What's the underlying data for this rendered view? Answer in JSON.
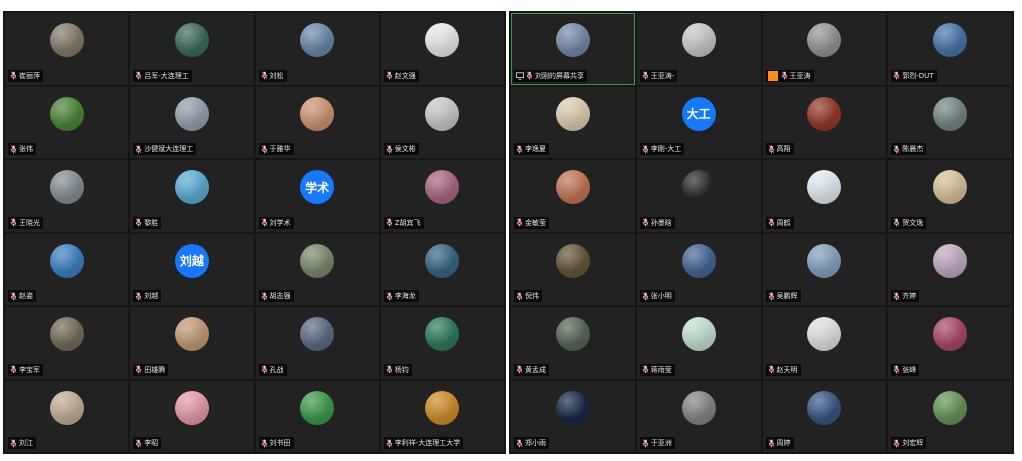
{
  "colors": {
    "background": "#161616",
    "tile": "#222222",
    "caption_bg": "#000000",
    "caption_text": "#e6e6e6",
    "active_border": "#2ea043",
    "text_avatar_blue": "#1677ff"
  },
  "left_panel": [
    {
      "name": "崔丽萍",
      "avatar": "photo",
      "color": "#8a7f6e"
    },
    {
      "name": "吕军-大连理工",
      "avatar": "photo",
      "color": "#3f6f5e"
    },
    {
      "name": "刘松",
      "avatar": "photo",
      "color": "#6f8fb0"
    },
    {
      "name": "赵文强",
      "avatar": "cartoon",
      "color": "#f2f2f2"
    },
    {
      "name": "张伟",
      "avatar": "photo",
      "color": "#4f8a3a"
    },
    {
      "name": "沙健斌大连理工",
      "avatar": "photo",
      "color": "#9aa7b5"
    },
    {
      "name": "于雅华",
      "avatar": "photo",
      "color": "#d79a7a"
    },
    {
      "name": "侯文彬",
      "avatar": "photo",
      "color": "#cfcfcf"
    },
    {
      "name": "王晓光",
      "avatar": "photo",
      "color": "#8a939b"
    },
    {
      "name": "黎胜",
      "avatar": "photo",
      "color": "#5fb3dd"
    },
    {
      "name": "刘学术",
      "avatar": "text",
      "initials": "学术",
      "color": "#1677ff"
    },
    {
      "name": "Z胡宾飞",
      "avatar": "photo",
      "color": "#b06a8a"
    },
    {
      "name": "赵姿",
      "avatar": "photo",
      "color": "#3f86c9"
    },
    {
      "name": "刘越",
      "avatar": "text",
      "initials": "刘越",
      "color": "#1677ff"
    },
    {
      "name": "胡志强",
      "avatar": "photo",
      "color": "#7f8f6f"
    },
    {
      "name": "李海龙",
      "avatar": "photo",
      "color": "#3a6a8a"
    },
    {
      "name": "李宝军",
      "avatar": "photo",
      "color": "#7a6f5a"
    },
    {
      "name": "田雄腾",
      "avatar": "photo",
      "color": "#c9a27a"
    },
    {
      "name": "孔战",
      "avatar": "photo",
      "color": "#5f6f8a"
    },
    {
      "name": "杨钧",
      "avatar": "photo",
      "color": "#2f7f5f"
    },
    {
      "name": "刘江",
      "avatar": "photo",
      "color": "#c9b49a"
    },
    {
      "name": "李昭",
      "avatar": "photo",
      "color": "#f0a0b0"
    },
    {
      "name": "刘书田",
      "avatar": "photo",
      "color": "#3fa04f"
    },
    {
      "name": "李利祥-大连理工大学",
      "avatar": "photo",
      "color": "#d7922a"
    }
  ],
  "right_panel": [
    {
      "name": "刘刚的屏幕共享",
      "avatar": "photo",
      "color": "#7a8fb0",
      "sharing": true,
      "active": true
    },
    {
      "name": "王亚涛-",
      "avatar": "photo",
      "color": "#cfcfcf"
    },
    {
      "name": "王亚涛",
      "avatar": "photo",
      "color": "#9a9a9a",
      "badge": true
    },
    {
      "name": "郭烈-DUT",
      "avatar": "photo",
      "color": "#4a7ab0"
    },
    {
      "name": "李逸夏",
      "avatar": "cartoon",
      "color": "#e7d4b5"
    },
    {
      "name": "李刚-大工",
      "avatar": "text",
      "initials": "大工",
      "color": "#1677ff"
    },
    {
      "name": "高翔",
      "avatar": "photo",
      "color": "#9a3a2a"
    },
    {
      "name": "陈晨杰",
      "avatar": "photo",
      "color": "#7a8a8a"
    },
    {
      "name": "金敏莹",
      "avatar": "photo",
      "color": "#c97a5a"
    },
    {
      "name": "孙墨晗",
      "avatar": "photo",
      "color": "#2a2a2a"
    },
    {
      "name": "周鹤",
      "avatar": "photo",
      "color": "#e9f3fa"
    },
    {
      "name": "贺文逸",
      "avatar": "photo",
      "color": "#e0c9a0"
    },
    {
      "name": "倪伟",
      "avatar": "photo",
      "color": "#6a5a3a"
    },
    {
      "name": "张小明",
      "avatar": "photo",
      "color": "#4a6a9a"
    },
    {
      "name": "吴鹏辉",
      "avatar": "photo",
      "color": "#8aa7c5"
    },
    {
      "name": "齐婷",
      "avatar": "photo",
      "color": "#c9b0c9"
    },
    {
      "name": "黄孟成",
      "avatar": "photo",
      "color": "#5a6a5a"
    },
    {
      "name": "蒋雨莹",
      "avatar": "photo",
      "color": "#c9e9d9"
    },
    {
      "name": "赵天明",
      "avatar": "photo",
      "color": "#e9e9e9"
    },
    {
      "name": "张峰",
      "avatar": "photo",
      "color": "#b04a6a"
    },
    {
      "name": "郑小雨",
      "avatar": "photo",
      "color": "#1a2a4a"
    },
    {
      "name": "于亚洲",
      "avatar": "photo",
      "color": "#8a8a8a"
    },
    {
      "name": "周婷",
      "avatar": "photo",
      "color": "#3a5a8a"
    },
    {
      "name": "刘宏辉",
      "avatar": "photo",
      "color": "#6a9a5a"
    }
  ]
}
